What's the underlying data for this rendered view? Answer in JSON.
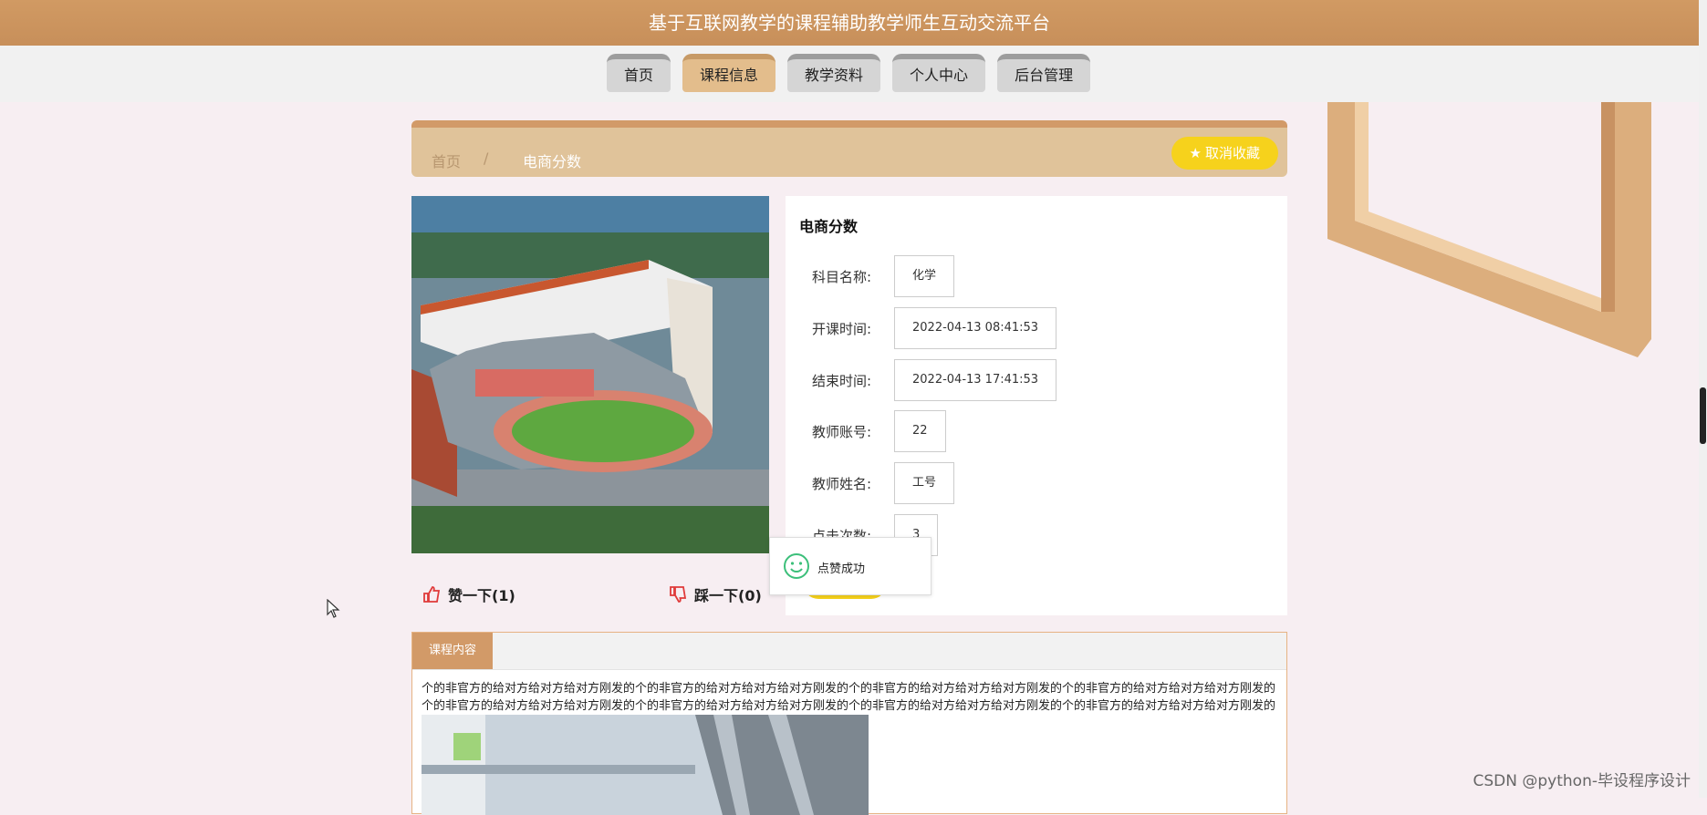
{
  "header": {
    "title": "基于互联网教学的课程辅助教学师生互动交流平台"
  },
  "nav": {
    "items": [
      {
        "label": "首页"
      },
      {
        "label": "课程信息",
        "active": true
      },
      {
        "label": "教学资料"
      },
      {
        "label": "个人中心"
      },
      {
        "label": "后台管理"
      }
    ]
  },
  "breadcrumb": {
    "home": "首页",
    "separator": "/",
    "current": "电商分数"
  },
  "actions": {
    "unfavorite_label": "取消收藏"
  },
  "detail": {
    "title": "电商分数",
    "fields": [
      {
        "label": "科目名称:",
        "value": "化学"
      },
      {
        "label": "开课时间:",
        "value": "2022-04-13 08:41:53"
      },
      {
        "label": "结束时间:",
        "value": "2022-04-13 17:41:53"
      },
      {
        "label": "教师账号:",
        "value": "22"
      },
      {
        "label": "教师姓名:",
        "value": "工号"
      },
      {
        "label": "点击次数:",
        "value": "3"
      }
    ]
  },
  "votes": {
    "like_label": "赞一下(1)",
    "dislike_label": "踩一下(0)"
  },
  "toast": {
    "message": "点赞成功"
  },
  "content": {
    "tab_label": "课程内容",
    "text": "个的非官方的给对方给对方给对方刚发的个的非官方的给对方给对方给对方刚发的个的非官方的给对方给对方给对方刚发的个的非官方的给对方给对方给对方刚发的个的非官方的给对方给对方给对方刚发的个的非官方的给对方给对方给对方刚发的个的非官方的给对方给对方给对方刚发的个的非官方的给对方给对方给对方刚发的"
  },
  "watermark": "CSDN @python-毕设程序设计",
  "colors": {
    "brand": "#c78f5a",
    "accent": "#f6d21c",
    "nav_active": "#e3bd8c"
  }
}
